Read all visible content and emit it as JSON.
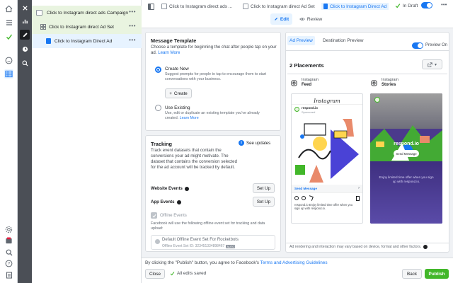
{
  "tree": {
    "campaign": "Click to Instagram direct ads Campaign",
    "adset": "Click to Instagram direct Ad Set",
    "ad": "Click to Instagram Direct Ad"
  },
  "topbar": {
    "crumbs": [
      "Click to Instagram direct ads ...",
      "Click to Instagram direct Ad Set",
      "Click to Instagram Direct Ad"
    ],
    "status": "In Draft",
    "edit": "Edit",
    "review": "Review"
  },
  "message_template": {
    "title": "Message Template",
    "desc": "Choose a template for beginning the chat after people tap on your ad.",
    "learn": "Learn More",
    "create_new": "Create New",
    "create_new_desc": "Suggest prompts for people to tap to encourage them to start conversations with your business.",
    "create_btn": "Create",
    "use_existing": "Use Existing",
    "use_existing_desc": "Use, edit or duplicate an existing template you've already created.",
    "learn_short": "Learn More"
  },
  "tracking": {
    "title": "Tracking",
    "see_updates": "See updates",
    "desc": "Track event datasets that contain the conversions your ad might motivate. The dataset that contains the conversion selected for the ad account will be tracked by default.",
    "website_events": "Website Events",
    "app_events": "App Events",
    "setup": "Set Up",
    "offline_events": "Offline Events",
    "offline_desc": "Facebook will use the following offline event set for tracking and data upload:",
    "default_set": "Default Offline Event Set For Rocketbots",
    "set_id": "Offline Event Set ID: 323451334898467",
    "auto": "AUTO",
    "more": "Manage Events  Manage Datasets"
  },
  "preview": {
    "tab_ad": "Ad Preview",
    "tab_dest": "Destination Preview",
    "preview_on": "Preview On",
    "placements": "2 Placements",
    "feed_label_1": "Instagram",
    "feed_label_2": "Feed",
    "stories_label_1": "Instagram",
    "stories_label_2": "Stories",
    "ig_logo": "Instagram",
    "account": "respond.io",
    "sponsored": "Sponsored",
    "send_message": "Send Message",
    "caption": "respond.io Enjoy limited time offer when you sign up with respond.io.",
    "story_brand": "respond.io",
    "story_btn": "Send Message",
    "story_caption": "Enjoy limited time offer when you sign up with respond.io.",
    "note": "Ad rendering and interaction may vary based on device, format and other factors."
  },
  "footer": {
    "text": "By clicking the \"Publish\" button, you agree to Facebook's",
    "terms": "Terms and Advertising Guidelines",
    "close": "Close",
    "saved": "All edits saved",
    "back": "Back",
    "publish": "Publish"
  },
  "colors": {
    "accent": "#1877f2",
    "publish": "#42b72a",
    "story_bg": "#4b3a8c"
  }
}
